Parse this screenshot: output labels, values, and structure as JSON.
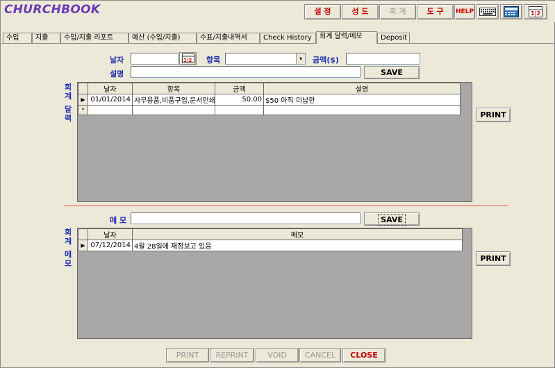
{
  "app": {
    "title": "CHURCHBOOK"
  },
  "toolbar": {
    "settings": "설 정",
    "members": "성 도",
    "accounting": "회 계",
    "tools": "도 구",
    "help": "HELP"
  },
  "tabs": [
    {
      "label": "수입"
    },
    {
      "label": "지출"
    },
    {
      "label": "수입/지출 리포트"
    },
    {
      "label": "예산 (수입/지출)"
    },
    {
      "label": "수표/지출내역서"
    },
    {
      "label": "Check History"
    },
    {
      "label": "회계 달력/메모"
    },
    {
      "label": "Deposit"
    }
  ],
  "form": {
    "date_label": "날자",
    "item_label": "항목",
    "amount_label": "금액($)",
    "desc_label": "설명",
    "save_label": "SAVE",
    "date_value": "",
    "amount_value": "",
    "desc_value": "",
    "item_value": ""
  },
  "calendar_section": {
    "side_label_1": "회",
    "side_label_2": "계",
    "side_label_3": "달",
    "side_label_4": "력",
    "columns": [
      "날자",
      "항목",
      "금액",
      "설명"
    ],
    "rows": [
      {
        "date": "01/01/2014",
        "item": "사무용품,비품구입,문서인쇄",
        "amount": "50.00",
        "desc": "$50 아직 미납한"
      }
    ],
    "new_row_marker": "*",
    "print_label": "PRINT"
  },
  "memo_form": {
    "memo_label": "메 모",
    "memo_value": "",
    "save_label": "SAVE"
  },
  "memo_section": {
    "side_label_1": "회",
    "side_label_2": "계",
    "side_label_3": "메",
    "side_label_4": "모",
    "columns": [
      "날자",
      "메모"
    ],
    "rows": [
      {
        "date": "07/12/2014",
        "memo": "4월 28일에 재정보고 있음"
      }
    ],
    "print_label": "PRINT"
  },
  "footer": {
    "print": "PRINT",
    "reprint": "REPRINT",
    "void": "VOID",
    "cancel": "CANCEL",
    "close": "CLOSE"
  },
  "colors": {
    "accent_blue": "#1f2fb0",
    "logo_purple": "#6a3ab5",
    "toolbar_red": "#c00000",
    "separator": "#e05050"
  }
}
